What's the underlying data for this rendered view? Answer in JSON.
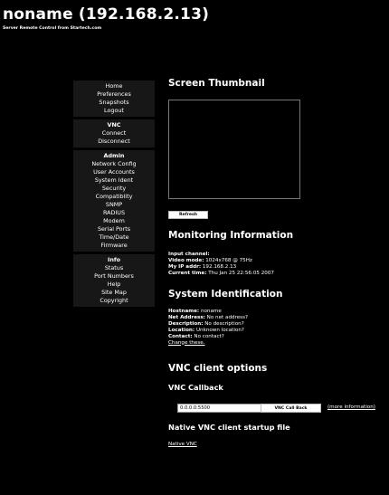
{
  "header": {
    "title": "noname (192.168.2.13)",
    "subtitle": "Server Remote Control from Startech.com"
  },
  "nav": {
    "group1": [
      "Home",
      "Preferences",
      "Snapshots",
      "Logout"
    ],
    "vnc": {
      "head": "VNC",
      "items": [
        "Connect",
        "Disconnect"
      ]
    },
    "admin": {
      "head": "Admin",
      "items": [
        "Network Config",
        "User Accounts",
        "System Ident",
        "Security",
        "Compatiblity",
        "SNMP",
        "RADIUS",
        "Modem",
        "Serial Ports",
        "Time/Date",
        "Firmware"
      ]
    },
    "info": {
      "head": "Info",
      "items": [
        "Status",
        "Port Numbers",
        "Help",
        "Site Map",
        "Copyright"
      ]
    }
  },
  "thumbnail": {
    "title": "Screen Thumbnail",
    "refresh_label": "Refresh"
  },
  "monitoring": {
    "title": "Monitoring Information",
    "input_channel_label": "Input channel:",
    "input_channel_value": "",
    "video_mode_label": "Video mode:",
    "video_mode_value": "1024x768 @ 75Hz",
    "ip_label": "My IP addr:",
    "ip_value": "192.168.2.13",
    "time_label": "Current time:",
    "time_value": "Thu Jan 25 22:56:05 2007"
  },
  "system_id": {
    "title": "System Identification",
    "hostname_label": "Hostname:",
    "hostname_value": "noname",
    "net_label": "Net Address:",
    "net_value": "No net address?",
    "desc_label": "Description:",
    "desc_value": "No description?",
    "loc_label": "Location:",
    "loc_value": "Unknown location?",
    "contact_label": "Contact:",
    "contact_value": "No contact?",
    "change_link": "Change these."
  },
  "vnc_client": {
    "title": "VNC client options",
    "callback_title": "VNC Callback",
    "callback_value": "0.0.0.0:5500",
    "callback_button": "VNC Call Back",
    "more_info": "(more information)",
    "native_title": "Native VNC client startup file",
    "native_link": "Native VNC"
  }
}
